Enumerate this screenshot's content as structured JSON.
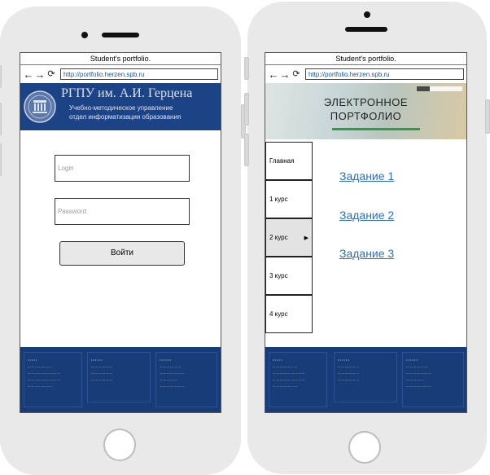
{
  "left_phone": {
    "browser": {
      "window_title": "Student's portfolio.",
      "url": "http://portfolio.herzen.spb.ru"
    },
    "banner": {
      "title": "РГПУ им. А.И. Герцена",
      "subtitle1": "Учебно-методическое управление",
      "subtitle2": "отдел информатизации образования"
    },
    "login_form": {
      "login_placeholder": "Login",
      "password_placeholder": "Password",
      "submit_label": "Войти"
    }
  },
  "right_phone": {
    "browser": {
      "window_title": "Student's portfolio.",
      "url": "http://portfolio.herzen.spb.ru"
    },
    "hero": {
      "line1": "ЭЛЕКТРОННОЕ",
      "line2": "ПОРТФОЛИО"
    },
    "menu": [
      {
        "label": "Главная"
      },
      {
        "label": "1 курс"
      },
      {
        "label": "2 курс"
      },
      {
        "label": "3 курс"
      },
      {
        "label": "4 курс"
      }
    ],
    "tasks": [
      {
        "label": "Задание 1"
      },
      {
        "label": "Задание 2"
      },
      {
        "label": "Задание 3"
      }
    ]
  },
  "colors": {
    "phone_body": "#e9e9e9",
    "footer_bg": "#173c78",
    "banner_bg": "#1d4387",
    "link": "#2c6fbd",
    "menu_selected": "#e3e3e3"
  }
}
